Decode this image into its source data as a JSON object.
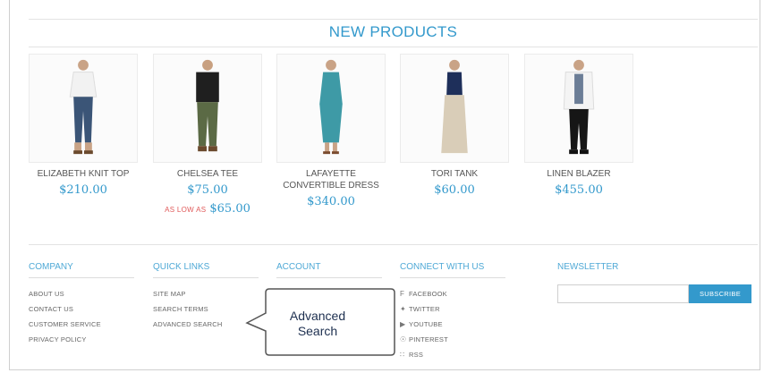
{
  "section_title": "NEW PRODUCTS",
  "products": [
    {
      "name": "ELIZABETH KNIT TOP",
      "price": "$210.00"
    },
    {
      "name": "CHELSEA TEE",
      "price": "$75.00",
      "as_low_as_label": "AS LOW AS",
      "as_low_as_price": "$65.00"
    },
    {
      "name": "LAFAYETTE CONVERTIBLE DRESS",
      "price": "$340.00"
    },
    {
      "name": "TORI TANK",
      "price": "$60.00"
    },
    {
      "name": "LINEN BLAZER",
      "price": "$455.00"
    }
  ],
  "footer": {
    "company": {
      "title": "COMPANY",
      "links": [
        "ABOUT US",
        "CONTACT US",
        "CUSTOMER SERVICE",
        "PRIVACY POLICY"
      ]
    },
    "quick_links": {
      "title": "QUICK LINKS",
      "links": [
        "SITE MAP",
        "SEARCH TERMS",
        "ADVANCED SEARCH"
      ]
    },
    "account": {
      "title": "ACCOUNT"
    },
    "connect": {
      "title": "CONNECT WITH US",
      "links": [
        {
          "icon": "facebook-icon",
          "label": "FACEBOOK"
        },
        {
          "icon": "twitter-icon",
          "label": "TWITTER"
        },
        {
          "icon": "youtube-icon",
          "label": "YOUTUBE"
        },
        {
          "icon": "pinterest-icon",
          "label": "PINTEREST"
        },
        {
          "icon": "rss-icon",
          "label": "RSS"
        }
      ]
    },
    "newsletter": {
      "title": "NEWSLETTER",
      "placeholder": "",
      "button": "SUBSCRIBE"
    }
  },
  "callout": {
    "line1": "Advanced",
    "line2": "Search"
  },
  "colors": {
    "accent": "#3399cc",
    "sale": "#e05a5a"
  }
}
